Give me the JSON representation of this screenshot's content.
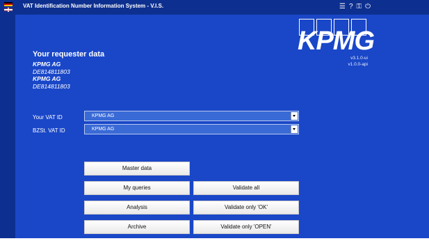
{
  "window": {
    "title": "VAT Identification Number Information System - V.I.S.",
    "icons": [
      "menu-list-icon",
      "help-icon",
      "key-icon",
      "power-icon"
    ],
    "icon_glyphs": [
      "☰",
      "?",
      "⚿",
      "⏻"
    ]
  },
  "logo": {
    "text": "KPMG"
  },
  "version": {
    "ui": "v3.1.0-ui",
    "api": "v1.0.0-api"
  },
  "requester": {
    "title": "Your requester data",
    "lines": [
      "KPMG AG",
      "DE814811803",
      "KPMG AG",
      "DE814811803"
    ]
  },
  "fields": {
    "vat_id": {
      "label": "Your VAT ID",
      "value": "KPMG AG"
    },
    "bzst_vat_id": {
      "label": "BZSt. VAT ID",
      "value": "KPMG AG"
    }
  },
  "buttons": {
    "master_data": "Master data",
    "my_queries": "My queries",
    "analysis": "Analysis",
    "archive": "Archive",
    "validate_all": "Validate all",
    "validate_ok": "Validate only 'OK'",
    "validate_open": "Validate only 'OPEN'"
  },
  "colors": {
    "background": "#1a47c8",
    "titlebar": "#0d2f8f",
    "button": "#ffffff"
  }
}
